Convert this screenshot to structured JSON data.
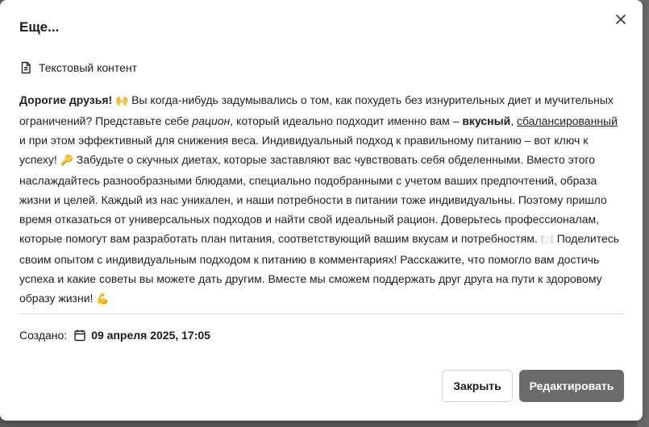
{
  "modal": {
    "title": "Еще...",
    "section_label": "Текстовый контент",
    "icons": {
      "close": "close-icon",
      "document": "document-icon",
      "calendar": "calendar-icon"
    }
  },
  "content": {
    "greeting": "Дорогие друзья!",
    "emoji_raise": "🙌",
    "t1": " Вы когда-нибудь задумывались о том, как похудеть без изнурительных диет и мучительных ограничений? Представьте себе ",
    "ration": "рацион",
    "t2": ", который идеально подходит именно вам – ",
    "tasty": "вкусный",
    "comma": ", ",
    "balanced": "сбалансированный ",
    "t3": "и при этом эффективный для снижения веса. Индивидуальный подход к правильному питанию – вот ключ к успеху! ",
    "emoji_key": "🔑",
    "t4": " Забудьте о скучных диетах, которые заставляют вас чувствовать себя обделенными. Вместо этого наслаждайтесь разнообразными блюдами, специально подобранными с учетом ваших предпочтений, образа жизни и целей. Каждый из нас уникален, и наши потребности в питании тоже индивидуальны. Поэтому пришло время отказаться от универсальных подходов и найти свой идеальный рацион. Доверьтесь профессионалам, которые помогут вам разработать план питания, соответствующий вашим вкусам и потребностям. ",
    "emoji_plate": "🍽️",
    "t5": " Поделитесь своим опытом с индивидуальным подходом к питанию в комментариях! Расскажите, что помогло вам достичь успеха и какие советы вы можете дать другим. Вместе мы сможем поддержать друг друга на пути к здоровому образу жизни! ",
    "emoji_muscle": "💪"
  },
  "created": {
    "label": "Создано:",
    "date": "09 апреля 2025, 17:05"
  },
  "buttons": {
    "close": "Закрыть",
    "edit": "Редактировать"
  },
  "colors": {
    "primary_button": "#6b6b6b",
    "divider": "#ead9dd",
    "backdrop": "#5a5a5a"
  }
}
